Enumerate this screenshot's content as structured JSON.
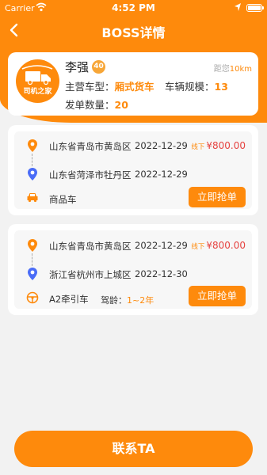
{
  "status_bar": {
    "carrier": "Carrier",
    "time": "4:52 PM"
  },
  "nav": {
    "title": "BOSS详情",
    "back_icon": "chevron-left-icon"
  },
  "profile": {
    "logo_text": "司机之家",
    "name": "李强",
    "level": "40",
    "distance_label": "距您",
    "distance_value": "10km",
    "main_vehicle_label": "主营车型：",
    "main_vehicle_value": "厢式货车",
    "fleet_scale_label": "车辆规模：",
    "fleet_scale_value": "13",
    "orders_label": "发单数量：",
    "orders_value": "20"
  },
  "orders": [
    {
      "from": "山东省青岛市黄岛区",
      "from_date": "2022-12-29",
      "to": "山东省菏泽市牡丹区",
      "to_date": "2022-12-29",
      "price_tag": "线下",
      "price": "¥800.00",
      "vehicle": "商品车",
      "button": "立即抢单"
    },
    {
      "from": "山东省青岛市黄岛区",
      "from_date": "2022-12-29",
      "to": "浙江省杭州市上城区",
      "to_date": "2022-12-30",
      "price_tag": "线下",
      "price": "¥800.00",
      "vehicle": "A2牵引车",
      "driving_age_label": "驾龄：",
      "driving_age_value": "1~2年",
      "button": "立即抢单"
    }
  ],
  "bottom_button": {
    "label": "联系TA"
  },
  "colors": {
    "accent": "#fe8a0c",
    "price": "#e64340",
    "pin_from": "#fe8a0c",
    "pin_to": "#4a6cf7"
  }
}
